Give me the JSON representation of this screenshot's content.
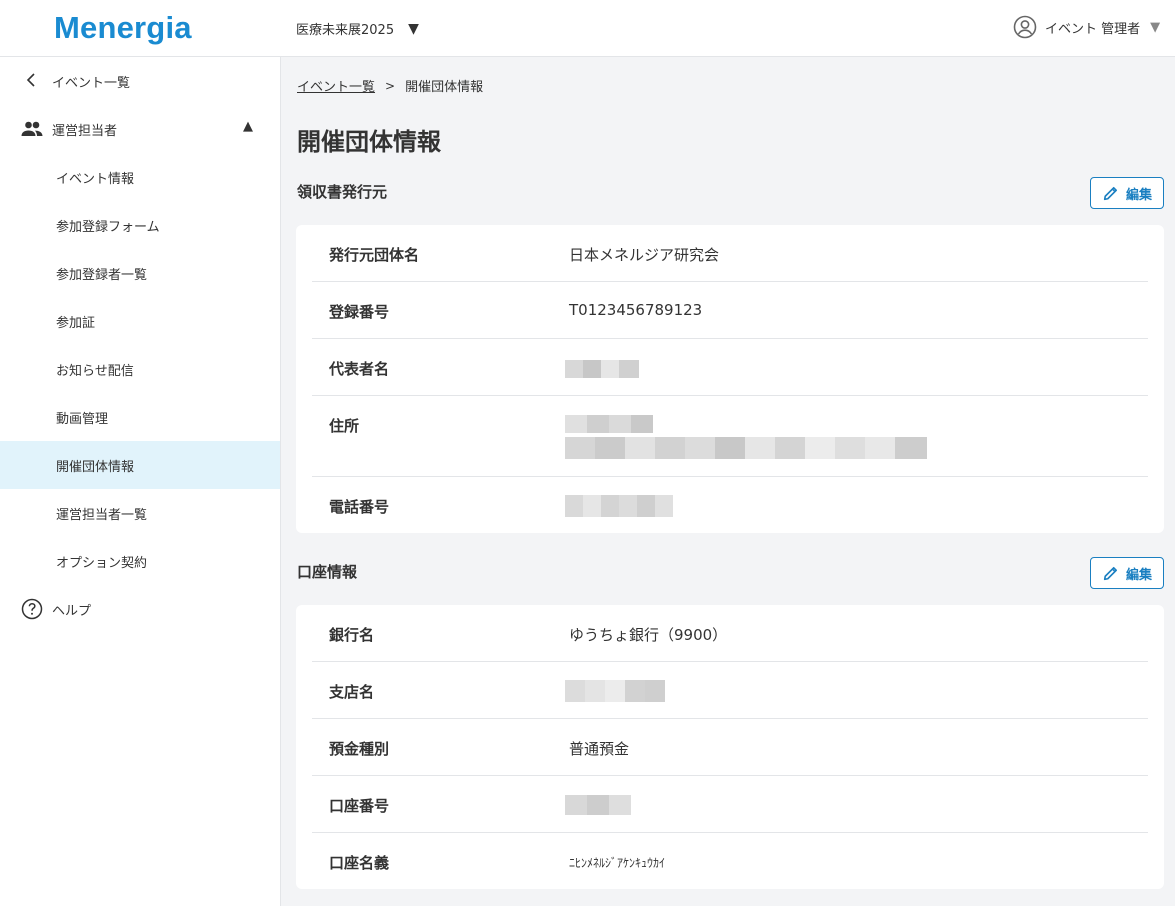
{
  "header": {
    "logo": "Menergia",
    "event_name": "医療未来展2025",
    "user_name": "イベント 管理者"
  },
  "sidebar": {
    "back_label": "イベント一覧",
    "group_label": "運営担当者",
    "items": [
      {
        "label": "イベント情報"
      },
      {
        "label": "参加登録フォーム"
      },
      {
        "label": "参加登録者一覧"
      },
      {
        "label": "参加証"
      },
      {
        "label": "お知らせ配信"
      },
      {
        "label": "動画管理"
      },
      {
        "label": "開催団体情報"
      },
      {
        "label": "運営担当者一覧"
      },
      {
        "label": "オプション契約"
      }
    ],
    "help_label": "ヘルプ"
  },
  "breadcrumb": {
    "parent": "イベント一覧",
    "current": "開催団体情報"
  },
  "page": {
    "title": "開催団体情報",
    "edit_label": "編集"
  },
  "receipt": {
    "title": "領収書発行元",
    "rows": [
      {
        "key": "発行元団体名",
        "value": "日本メネルジア研究会"
      },
      {
        "key": "登録番号",
        "value": "T0123456789123"
      },
      {
        "key": "代表者名",
        "value": ""
      },
      {
        "key": "住所",
        "value": ""
      },
      {
        "key": "電話番号",
        "value": ""
      }
    ]
  },
  "account": {
    "title": "口座情報",
    "rows": [
      {
        "key": "銀行名",
        "value": "ゆうちょ銀行（9900）"
      },
      {
        "key": "支店名",
        "value": ""
      },
      {
        "key": "預金種別",
        "value": "普通預金"
      },
      {
        "key": "口座番号",
        "value": ""
      },
      {
        "key": "口座名義",
        "value": "ﾆﾋﾝﾒﾈﾙｼﾞｱｹﾝｷｭｳｶｲ"
      }
    ]
  },
  "colors": {
    "brand": "#1a8bd1",
    "accent": "#1a7fc1",
    "active_bg": "#e1f3fb"
  }
}
